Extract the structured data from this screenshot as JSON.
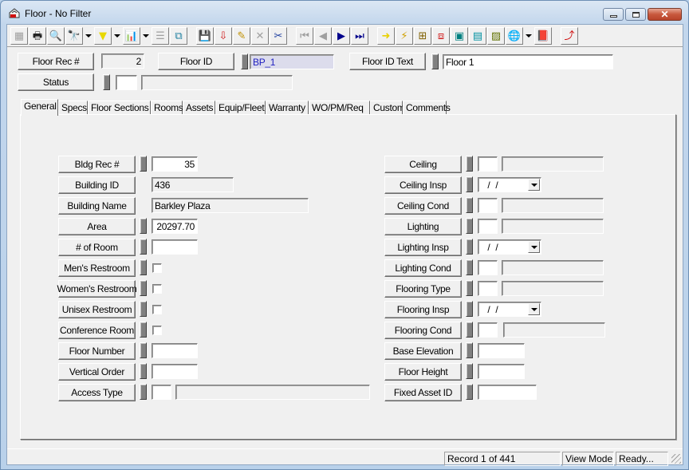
{
  "window": {
    "title": "Floor - No Filter",
    "icon": "floor-app-icon",
    "controls": [
      "minimize",
      "maximize",
      "close"
    ]
  },
  "toolbar": {
    "buttons": [
      {
        "name": "view-icon",
        "glyph": "▦",
        "enabled": false
      },
      {
        "name": "print-icon",
        "glyph": "🖶",
        "enabled": true
      },
      {
        "name": "preview-icon",
        "glyph": "🔍",
        "enabled": true
      },
      {
        "name": "find-icon",
        "glyph": "🔭",
        "enabled": true,
        "dropdown": true
      },
      {
        "name": "filter-icon",
        "glyph": "▼",
        "enabled": true,
        "dropdown": true
      },
      {
        "name": "report-icon",
        "glyph": "📊",
        "enabled": true,
        "dropdown": true
      },
      {
        "name": "properties-icon",
        "glyph": "☰",
        "enabled": false
      },
      {
        "name": "copy-record-icon",
        "glyph": "⧉",
        "enabled": true
      },
      {
        "name": "save-icon",
        "glyph": "💾",
        "enabled": false
      },
      {
        "name": "add-record-icon",
        "glyph": "⇩",
        "enabled": true
      },
      {
        "name": "edit-icon",
        "glyph": "✎",
        "enabled": true
      },
      {
        "name": "delete-icon",
        "glyph": "✕",
        "enabled": false
      },
      {
        "name": "cut-icon",
        "glyph": "✂",
        "enabled": true
      },
      {
        "name": "first-record-icon",
        "glyph": "⏮",
        "enabled": false
      },
      {
        "name": "prev-record-icon",
        "glyph": "◀",
        "enabled": false
      },
      {
        "name": "next-record-icon",
        "glyph": "▶",
        "enabled": true
      },
      {
        "name": "last-record-icon",
        "glyph": "⏭",
        "enabled": true
      },
      {
        "name": "goto-icon",
        "glyph": "➜",
        "enabled": true
      },
      {
        "name": "quick-action-icon",
        "glyph": "⚡",
        "enabled": true
      },
      {
        "name": "hierarchy-icon",
        "glyph": "⊞",
        "enabled": true
      },
      {
        "name": "link-icon",
        "glyph": "⧈",
        "enabled": true
      },
      {
        "name": "cad-icon",
        "glyph": "▣",
        "enabled": true
      },
      {
        "name": "calculator-icon",
        "glyph": "▤",
        "enabled": true
      },
      {
        "name": "map-icon",
        "glyph": "▨",
        "enabled": true
      },
      {
        "name": "web-icon",
        "glyph": "🌐",
        "enabled": true,
        "dropdown": true
      },
      {
        "name": "help-book-icon",
        "glyph": "📕",
        "enabled": true
      },
      {
        "name": "exit-icon",
        "glyph": "⤴",
        "enabled": true
      }
    ]
  },
  "header": {
    "floor_rec_label": "Floor Rec #",
    "floor_rec_value": "2",
    "floor_id_label": "Floor ID",
    "floor_id_value": "BP_1",
    "floor_id_text_label": "Floor ID Text",
    "floor_id_text_value": "Floor 1",
    "status_label": "Status",
    "status_code": "",
    "status_desc": ""
  },
  "tabs": [
    {
      "label": "General",
      "active": true
    },
    {
      "label": "Specs"
    },
    {
      "label": "Floor Sections"
    },
    {
      "label": "Rooms"
    },
    {
      "label": "Assets"
    },
    {
      "label": "Equip/Fleet"
    },
    {
      "label": "Warranty"
    },
    {
      "label": "WO/PM/Req"
    },
    {
      "label": "Custom"
    },
    {
      "label": "Comments"
    }
  ],
  "general": {
    "left": [
      {
        "label": "Bldg Rec #",
        "value": "35"
      },
      {
        "label": "Building ID",
        "value": "436"
      },
      {
        "label": "Building Name",
        "value": "Barkley Plaza"
      },
      {
        "label": "Area",
        "value": "20297.70"
      },
      {
        "label": "# of Room",
        "value": ""
      },
      {
        "label": "Men's Restroom",
        "checked": false
      },
      {
        "label": "Women's Restroom",
        "checked": false
      },
      {
        "label": "Unisex Restroom",
        "checked": false
      },
      {
        "label": "Conference Room",
        "checked": false
      },
      {
        "label": "Floor Number",
        "value": ""
      },
      {
        "label": "Vertical Order",
        "value": ""
      },
      {
        "label": "Access Type",
        "code": "",
        "desc": ""
      }
    ],
    "right": [
      {
        "label": "Ceiling",
        "code": "",
        "desc": ""
      },
      {
        "label": "Ceiling Insp",
        "date": " /  /"
      },
      {
        "label": "Ceiling Cond",
        "code": "",
        "desc": ""
      },
      {
        "label": "Lighting",
        "code": "",
        "desc": ""
      },
      {
        "label": "Lighting Insp",
        "date": " /  /"
      },
      {
        "label": "Lighting Cond",
        "code": "",
        "desc": ""
      },
      {
        "label": "Flooring Type",
        "code": "",
        "desc": ""
      },
      {
        "label": "Flooring Insp",
        "date": " /  /"
      },
      {
        "label": "Flooring Cond",
        "code": "",
        "desc": ""
      },
      {
        "label": "Base Elevation",
        "value": ""
      },
      {
        "label": "Floor Height",
        "value": ""
      },
      {
        "label": "Fixed Asset ID",
        "value": ""
      }
    ]
  },
  "statusbar": {
    "record": "Record 1 of 441",
    "mode": "View Mode",
    "state": "Ready..."
  }
}
